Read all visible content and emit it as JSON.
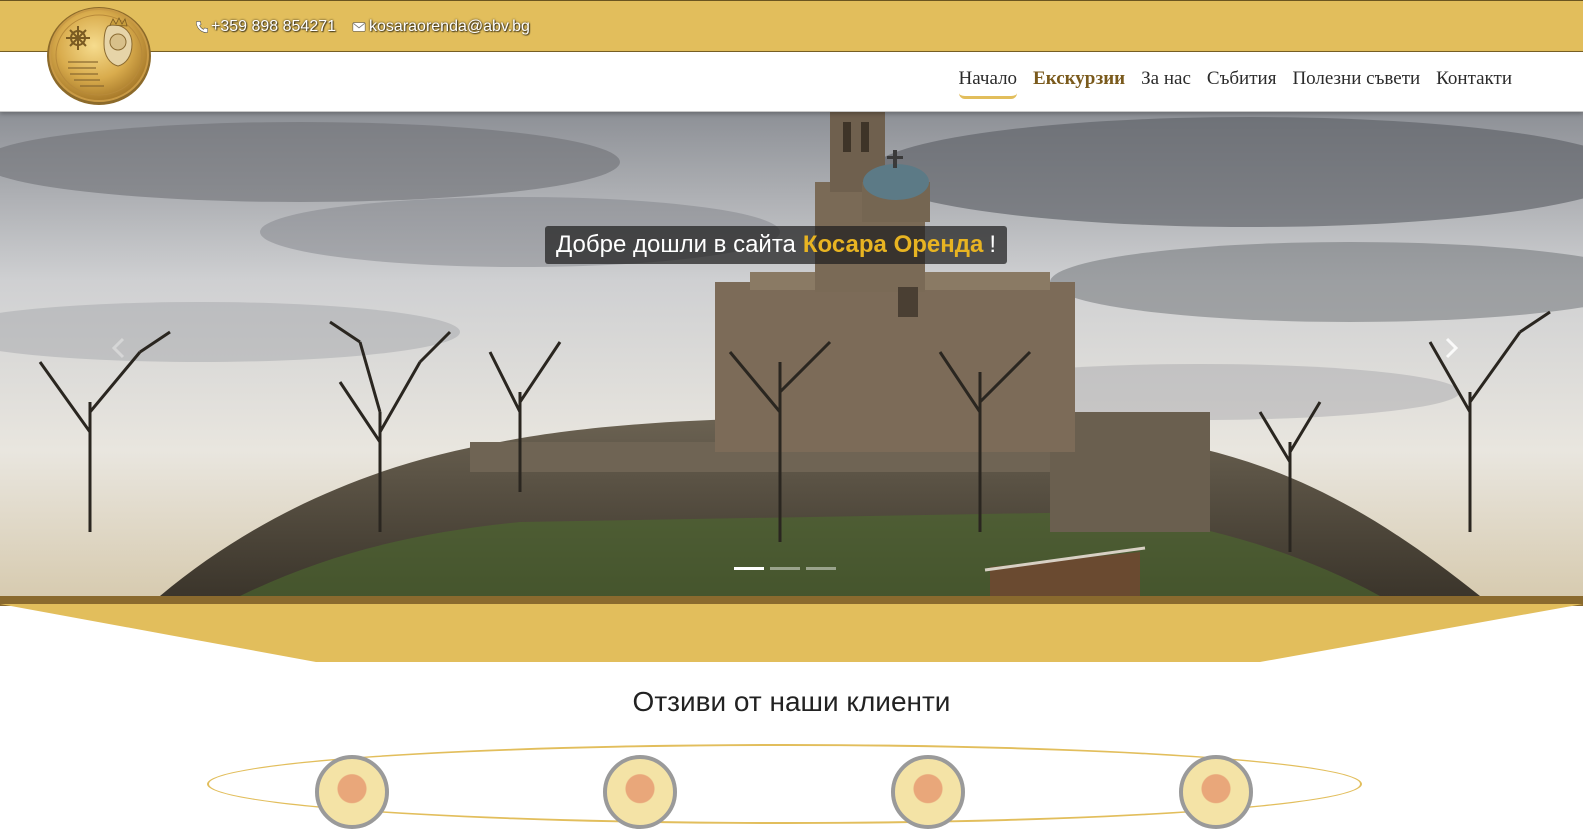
{
  "contact": {
    "phone": "+359 898 854271",
    "email": "kosaraorenda@abv.bg",
    "phone_icon": "phone-icon",
    "email_icon": "envelope-icon"
  },
  "nav": {
    "items": [
      "Начало",
      "Екскурзии",
      "За нас",
      "Събития",
      "Полезни съвети",
      "Контакти"
    ],
    "active_index": 0
  },
  "hero": {
    "welcome_text": "Добре дошли в сайта",
    "brand_name": "Косара Оренда",
    "exclamation": "!",
    "slide_count": 3,
    "current_slide": 1
  },
  "reviews": {
    "title": "Отзиви от наши клиенти",
    "avatar_count": 4
  },
  "colors": {
    "gold": "#e2be5c",
    "brand_text": "#e8b422",
    "brown": "#7a5a1c"
  }
}
